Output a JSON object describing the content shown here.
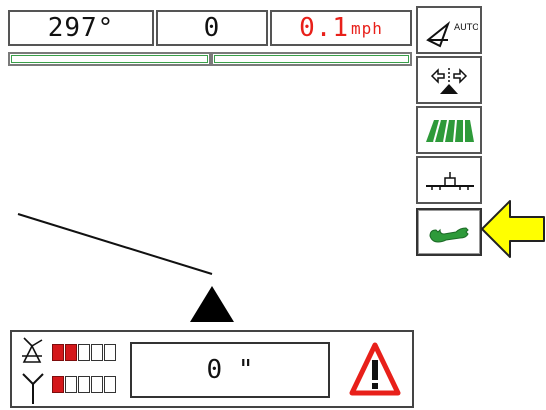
{
  "status_bar": {
    "heading_value": "297°",
    "middle_value": "0",
    "speed_value": "0.1",
    "speed_unit": "mph"
  },
  "side_toolbar": {
    "auto_label": "AUTO",
    "items": [
      {
        "name": "auto-steer-button",
        "icon": "vehicle-auto-icon"
      },
      {
        "name": "nudge-button",
        "icon": "left-right-nudge-icon"
      },
      {
        "name": "swath-button",
        "icon": "crop-rows-icon"
      },
      {
        "name": "implement-button",
        "icon": "implement-boom-icon"
      },
      {
        "name": "settings-button",
        "icon": "wrench-icon",
        "selected": true
      }
    ]
  },
  "guidance": {
    "vehicle_marker": "vehicle-triangle"
  },
  "status_panel": {
    "gps_signal_level": 2,
    "radio_signal_level": 1,
    "signal_total": 5,
    "cross_track_error": "0 \"",
    "warning": "warning-triangle-icon"
  },
  "colors": {
    "speed_text": "#e8201a",
    "signal_on": "#d4181b",
    "bar_green": "#3aa04a",
    "icon_green": "#2e9a3a",
    "highlight_arrow": "#ffff00"
  }
}
